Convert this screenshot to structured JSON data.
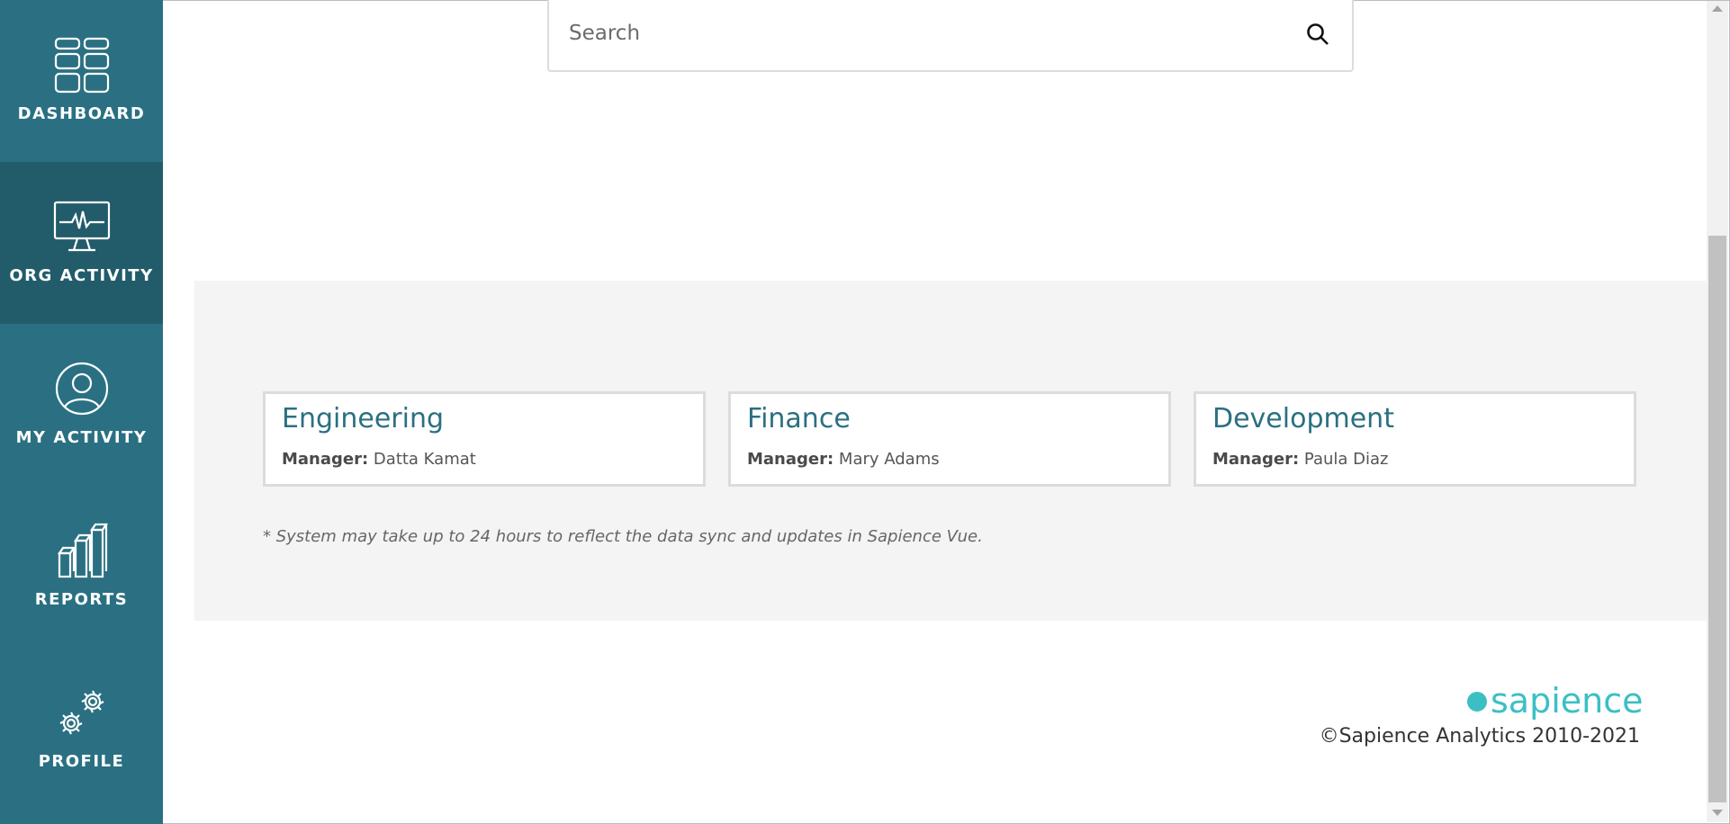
{
  "sidebar": {
    "items": [
      {
        "label": "DASHBOARD",
        "icon": "dashboard-grid-icon",
        "active": false
      },
      {
        "label": "ORG ACTIVITY",
        "icon": "monitor-pulse-icon",
        "active": true
      },
      {
        "label": "MY ACTIVITY",
        "icon": "user-circle-icon",
        "active": false
      },
      {
        "label": "REPORTS",
        "icon": "bar-chart-3d-icon",
        "active": false
      },
      {
        "label": "PROFILE",
        "icon": "gears-icon",
        "active": false
      }
    ]
  },
  "search": {
    "placeholder": "Search",
    "value": ""
  },
  "departments": [
    {
      "name": "Engineering",
      "manager_label": "Manager:",
      "manager": "Datta Kamat"
    },
    {
      "name": "Finance",
      "manager_label": "Manager:",
      "manager": "Mary Adams"
    },
    {
      "name": "Development",
      "manager_label": "Manager:",
      "manager": "Paula Diaz"
    }
  ],
  "note": "* System may take up to 24 hours to reflect the data sync and updates in Sapience Vue.",
  "footer": {
    "brand": "sapience",
    "copyright": "©Sapience Analytics 2010-2021"
  },
  "colors": {
    "sidebar": "#2a7082",
    "sidebar_active": "#225c6b",
    "accent": "#2a7082",
    "brand": "#3cbfc4"
  }
}
